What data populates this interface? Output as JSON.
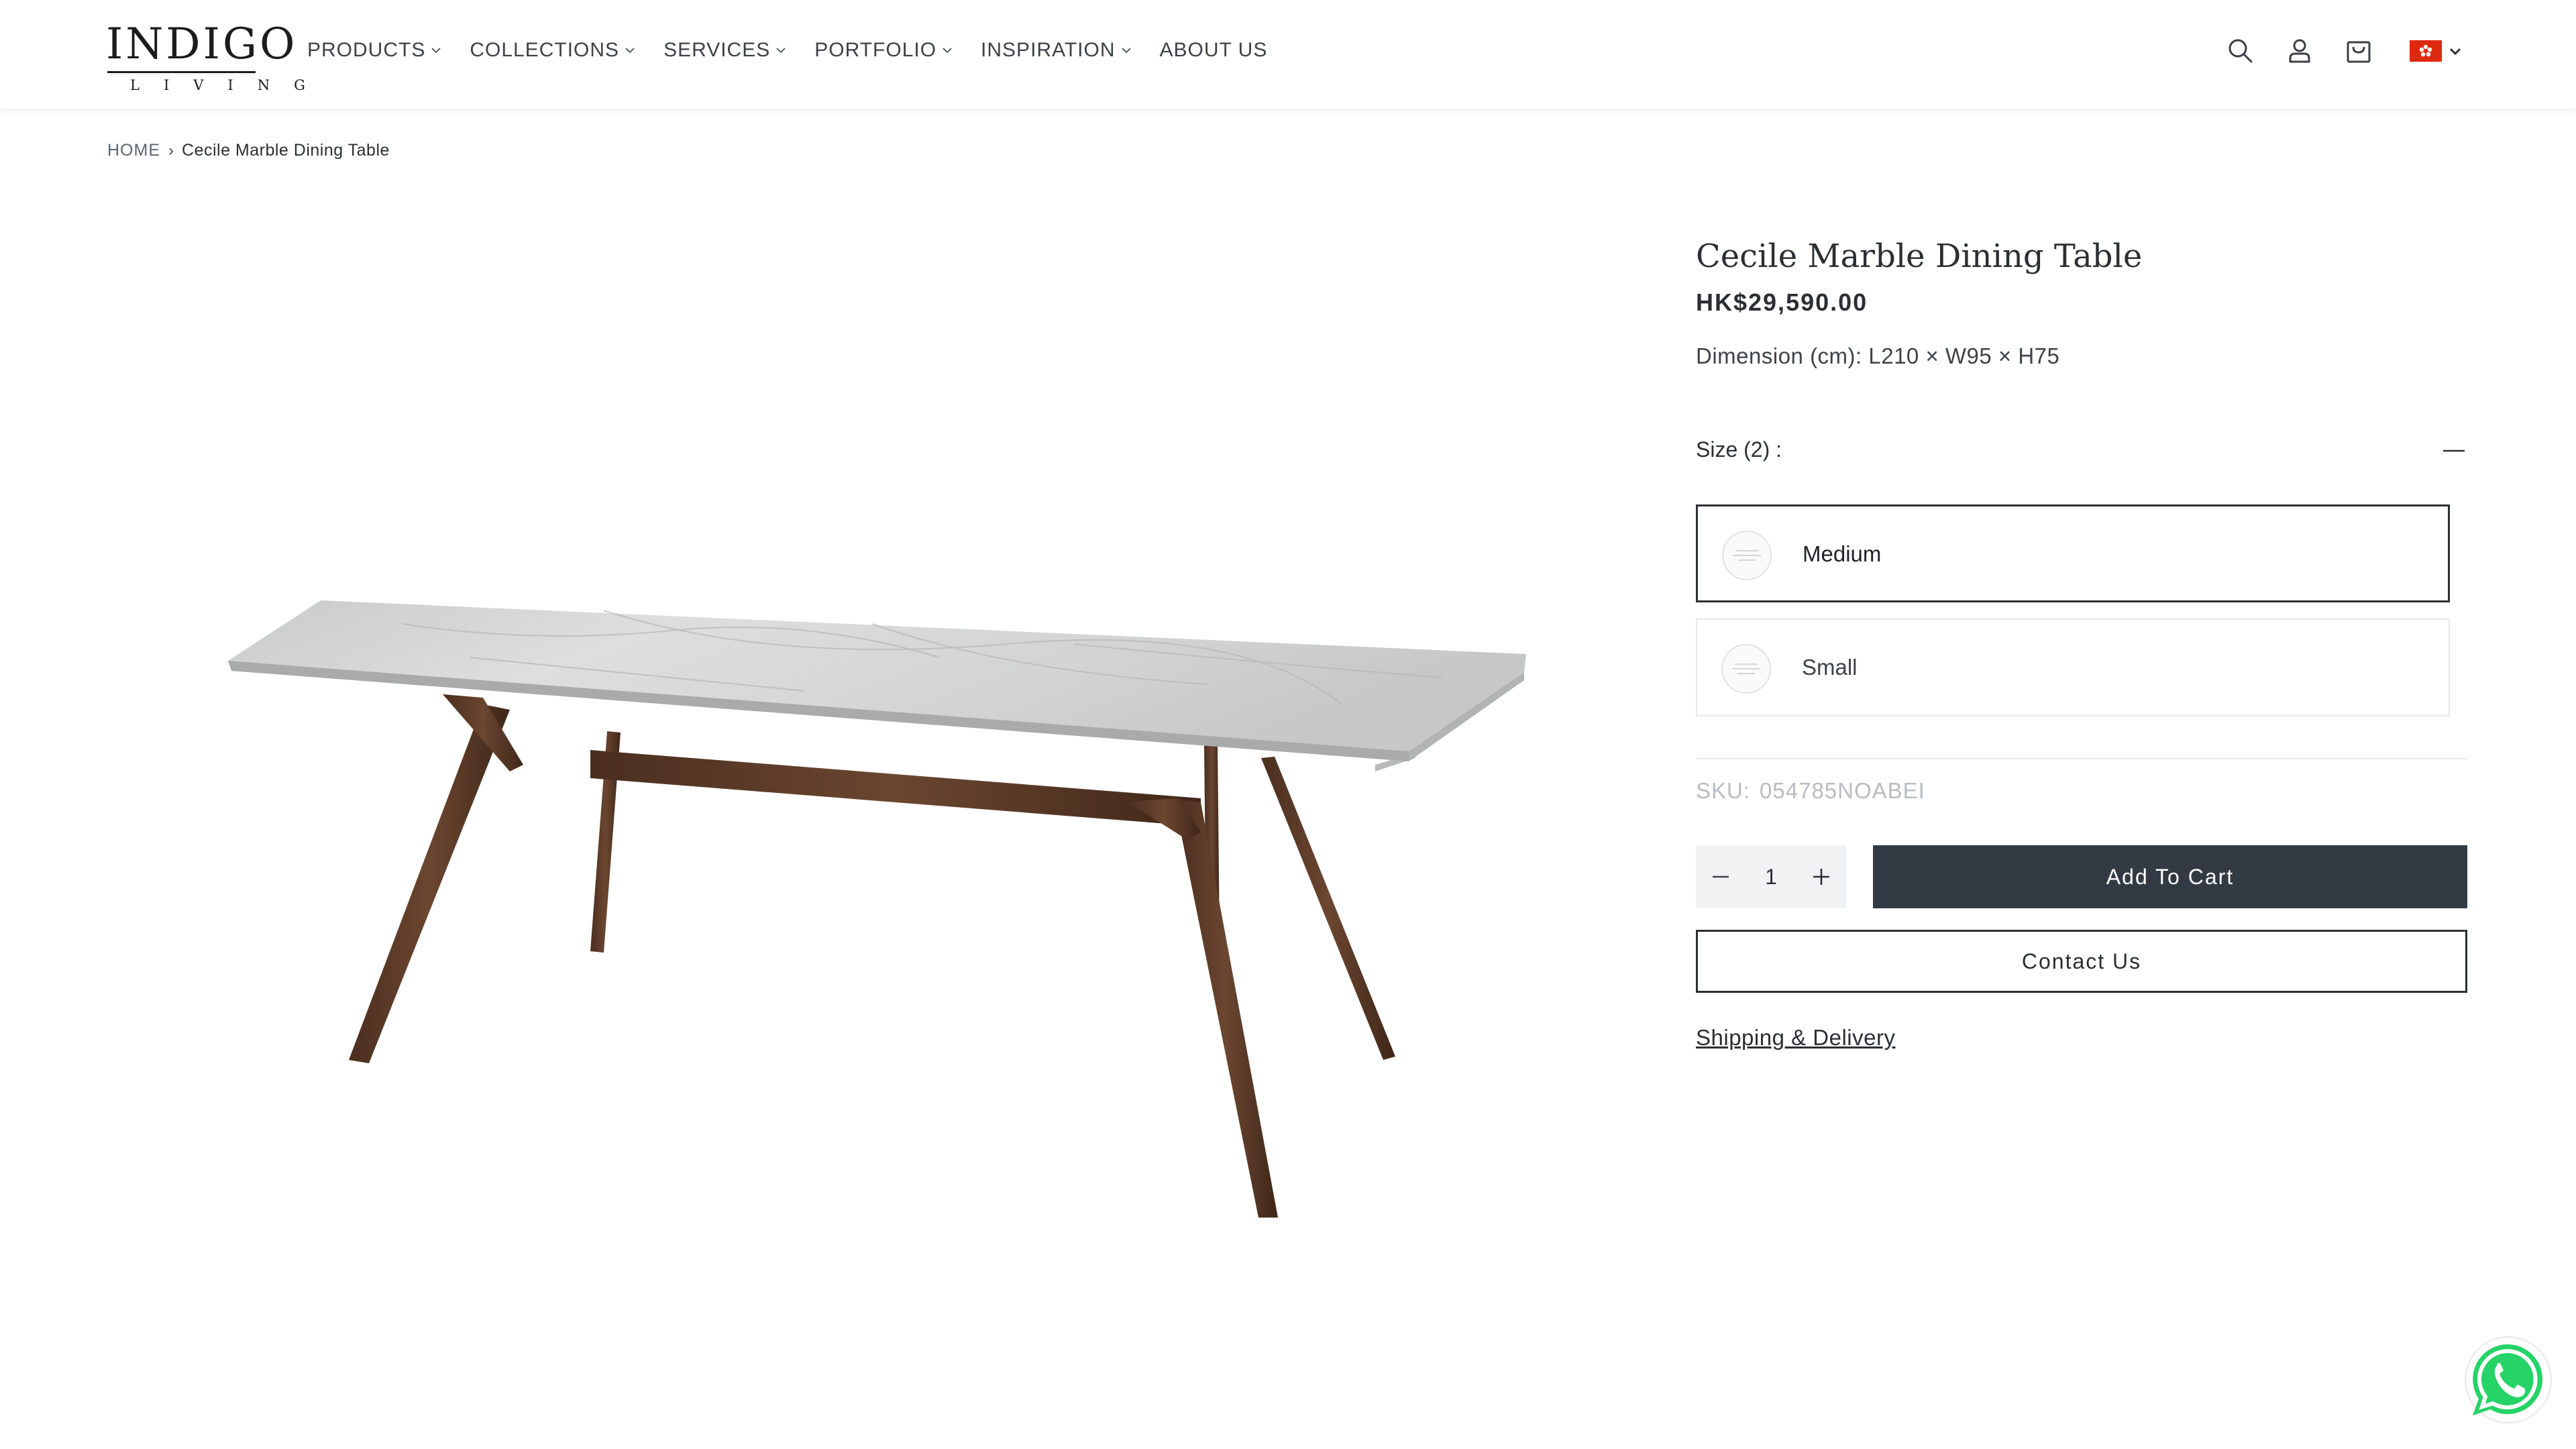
{
  "brand": {
    "name": "INDIGO",
    "sub": "LIVING"
  },
  "nav": {
    "items": [
      {
        "label": "PRODUCTS",
        "has_dropdown": true
      },
      {
        "label": "COLLECTIONS",
        "has_dropdown": true
      },
      {
        "label": "SERVICES",
        "has_dropdown": true
      },
      {
        "label": "PORTFOLIO",
        "has_dropdown": true
      },
      {
        "label": "INSPIRATION",
        "has_dropdown": true
      },
      {
        "label": "ABOUT US",
        "has_dropdown": false
      }
    ]
  },
  "header_icons": [
    "search-icon",
    "account-icon",
    "cart-icon",
    "hong-kong-flag-icon"
  ],
  "breadcrumb": {
    "home": "HOME",
    "separator": "›",
    "current": "Cecile Marble Dining Table"
  },
  "product": {
    "title": "Cecile Marble Dining Table",
    "price": "HK$29,590.00",
    "dimension": "Dimension (cm): L210 × W95 × H75",
    "size_label": "Size (2) :",
    "variants": [
      {
        "label": "Medium",
        "selected": true
      },
      {
        "label": "Small",
        "selected": false
      }
    ],
    "sku_label": "SKU:",
    "sku_value": "054785NOABEI",
    "quantity": "1",
    "add_to_cart": "Add To Cart",
    "contact": "Contact Us",
    "shipping": "Shipping & Delivery"
  },
  "colors": {
    "text": "#2b2f33",
    "button_dark": "#323b44",
    "flag_red": "#de2910",
    "whatsapp_green": "#25d366",
    "wood": "#5a3a26",
    "marble": "#cfd0d0"
  }
}
